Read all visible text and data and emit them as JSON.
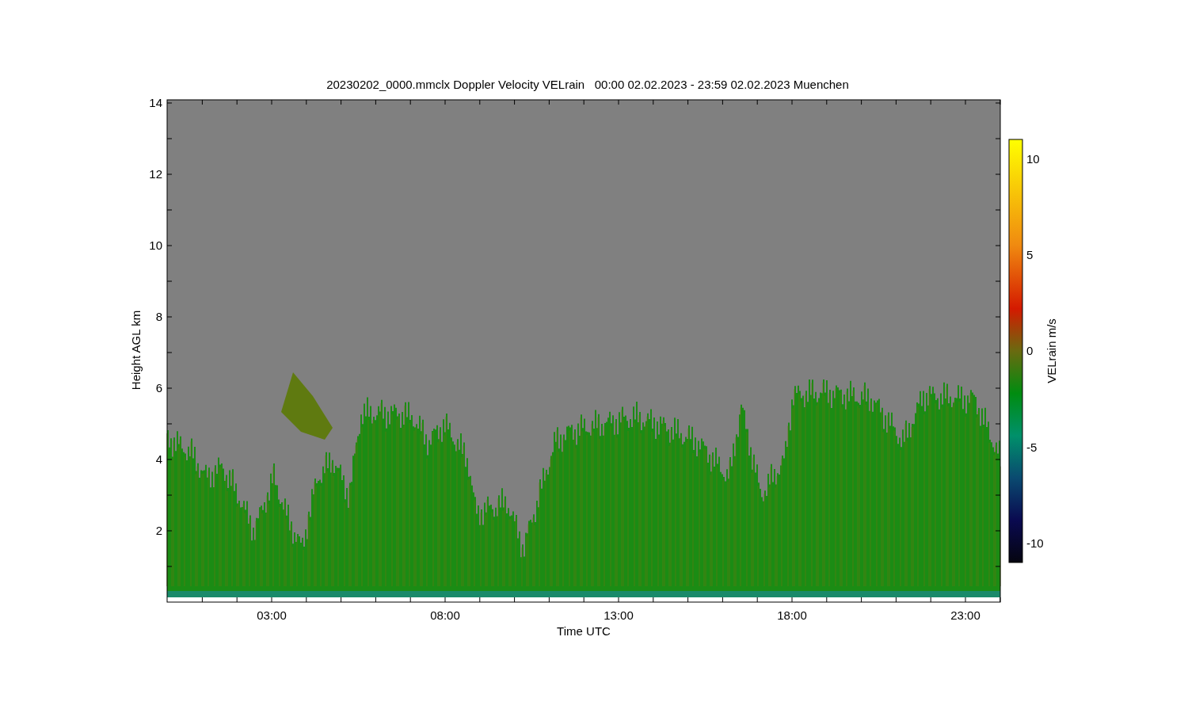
{
  "chart_title": "20230202_0000.mmclx Doppler Velocity VELrain   00:00 02.02.2023 - 23:59 02.02.2023 Muenchen",
  "y_axis": {
    "label": "Height AGL km",
    "ticks": [
      "14",
      "12",
      "10",
      "8",
      "6",
      "4",
      "2"
    ]
  },
  "x_axis": {
    "label": "Time UTC",
    "ticks": [
      "03:00",
      "08:00",
      "13:00",
      "18:00",
      "23:00"
    ]
  },
  "colorbar": {
    "label": "VELrain m/s",
    "ticks": [
      "10",
      "5",
      "0",
      "-5",
      "-10"
    ]
  }
}
